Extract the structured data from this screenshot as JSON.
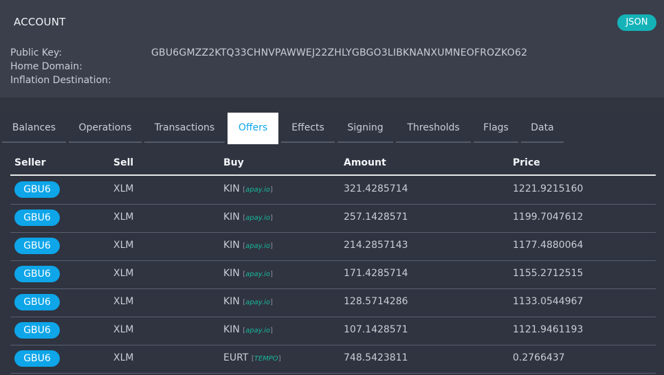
{
  "account": {
    "title": "ACCOUNT",
    "json_label": "JSON",
    "fields": [
      {
        "label": "Public Key:",
        "value": "GBU6GMZZ2KTQ33CHNVPAWWEJ22ZHLYGBGO3LIBKNANXUMNEOFROZKO62"
      },
      {
        "label": "Home Domain:",
        "value": ""
      },
      {
        "label": "Inflation Destination:",
        "value": ""
      }
    ]
  },
  "tabs": [
    {
      "label": "Balances"
    },
    {
      "label": "Operations"
    },
    {
      "label": "Transactions"
    },
    {
      "label": "Offers"
    },
    {
      "label": "Effects"
    },
    {
      "label": "Signing"
    },
    {
      "label": "Thresholds"
    },
    {
      "label": "Flags"
    },
    {
      "label": "Data"
    }
  ],
  "active_tab": "Offers",
  "table": {
    "headers": [
      "Seller",
      "Sell",
      "Buy",
      "Amount",
      "Price"
    ],
    "rows": [
      {
        "seller": "GBU6",
        "sell": "XLM",
        "buy": "KIN",
        "domain": "apay.io",
        "amount": "321.4285714",
        "price": "1221.9215160"
      },
      {
        "seller": "GBU6",
        "sell": "XLM",
        "buy": "KIN",
        "domain": "apay.io",
        "amount": "257.1428571",
        "price": "1199.7047612"
      },
      {
        "seller": "GBU6",
        "sell": "XLM",
        "buy": "KIN",
        "domain": "apay.io",
        "amount": "214.2857143",
        "price": "1177.4880064"
      },
      {
        "seller": "GBU6",
        "sell": "XLM",
        "buy": "KIN",
        "domain": "apay.io",
        "amount": "171.4285714",
        "price": "1155.2712515"
      },
      {
        "seller": "GBU6",
        "sell": "XLM",
        "buy": "KIN",
        "domain": "apay.io",
        "amount": "128.5714286",
        "price": "1133.0544967"
      },
      {
        "seller": "GBU6",
        "sell": "XLM",
        "buy": "KIN",
        "domain": "apay.io",
        "amount": "107.1428571",
        "price": "1121.9461193"
      },
      {
        "seller": "GBU6",
        "sell": "XLM",
        "buy": "EURT",
        "domain": "TEMPO",
        "amount": "748.5423811",
        "price": "0.2766437"
      }
    ]
  },
  "colors": {
    "accent": "#0ea5e9",
    "json_button": "#14b3b8",
    "domain_tag": "#19b69b",
    "background": "#2f3440"
  }
}
